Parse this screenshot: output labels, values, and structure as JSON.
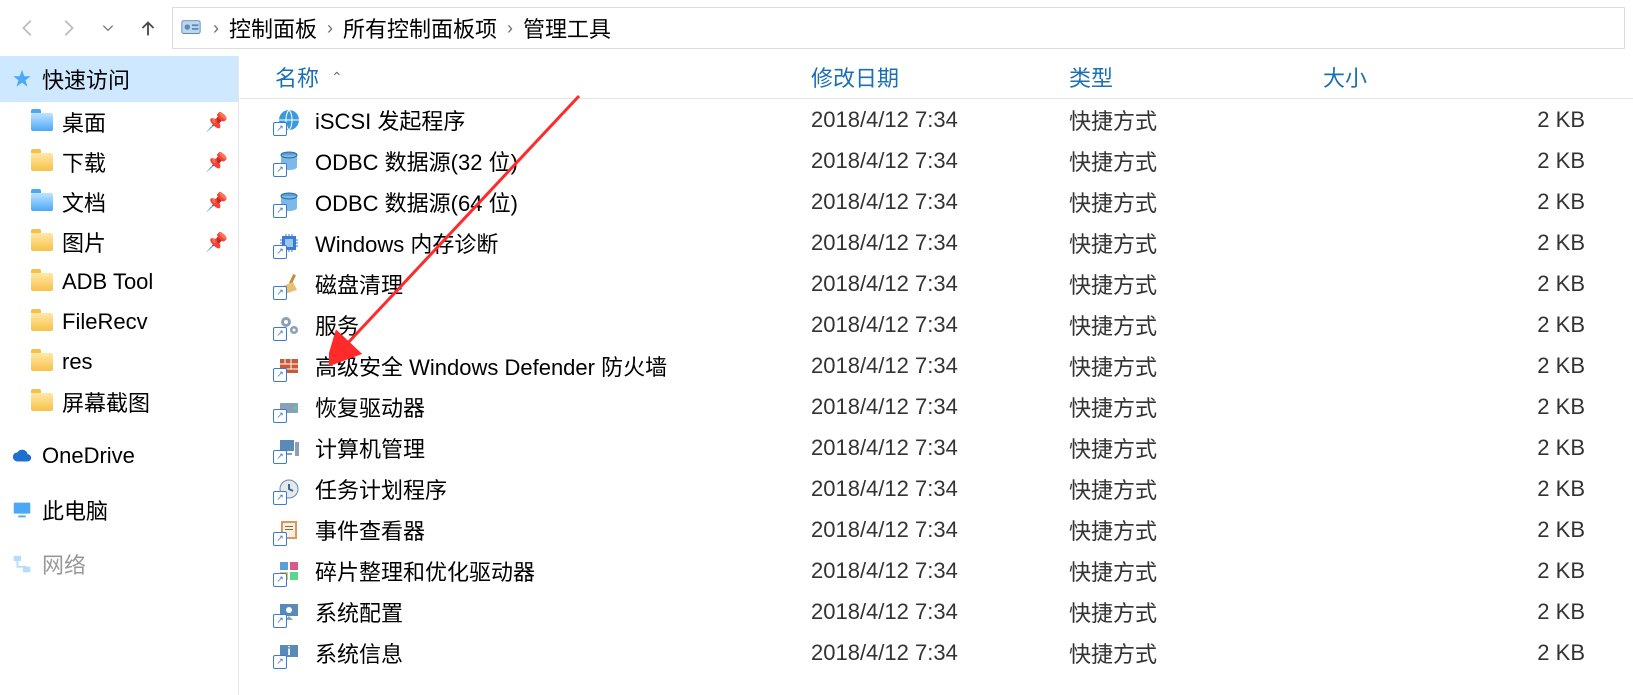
{
  "breadcrumbs": [
    "控制面板",
    "所有控制面板项",
    "管理工具"
  ],
  "nav": {
    "quick_access": "快速访问",
    "pinned": [
      {
        "label": "桌面",
        "color": "blue"
      },
      {
        "label": "下载",
        "color": "yellow"
      },
      {
        "label": "文档",
        "color": "blue"
      },
      {
        "label": "图片",
        "color": "yellow"
      }
    ],
    "recent": [
      {
        "label": "ADB Tool"
      },
      {
        "label": "FileRecv"
      },
      {
        "label": "res"
      },
      {
        "label": "屏幕截图"
      }
    ],
    "onedrive": "OneDrive",
    "this_pc": "此电脑",
    "network": "网络"
  },
  "columns": {
    "name": "名称",
    "date": "修改日期",
    "type": "类型",
    "size": "大小"
  },
  "rows": [
    {
      "name": "iSCSI 发起程序",
      "date": "2018/4/12 7:34",
      "type": "快捷方式",
      "size": "2 KB",
      "icon": "globe"
    },
    {
      "name": "ODBC 数据源(32 位)",
      "date": "2018/4/12 7:34",
      "type": "快捷方式",
      "size": "2 KB",
      "icon": "db"
    },
    {
      "name": "ODBC 数据源(64 位)",
      "date": "2018/4/12 7:34",
      "type": "快捷方式",
      "size": "2 KB",
      "icon": "db"
    },
    {
      "name": "Windows 内存诊断",
      "date": "2018/4/12 7:34",
      "type": "快捷方式",
      "size": "2 KB",
      "icon": "chip"
    },
    {
      "name": "磁盘清理",
      "date": "2018/4/12 7:34",
      "type": "快捷方式",
      "size": "2 KB",
      "icon": "broom"
    },
    {
      "name": "服务",
      "date": "2018/4/12 7:34",
      "type": "快捷方式",
      "size": "2 KB",
      "icon": "gears"
    },
    {
      "name": "高级安全 Windows Defender 防火墙",
      "date": "2018/4/12 7:34",
      "type": "快捷方式",
      "size": "2 KB",
      "icon": "wall"
    },
    {
      "name": "恢复驱动器",
      "date": "2018/4/12 7:34",
      "type": "快捷方式",
      "size": "2 KB",
      "icon": "disk"
    },
    {
      "name": "计算机管理",
      "date": "2018/4/12 7:34",
      "type": "快捷方式",
      "size": "2 KB",
      "icon": "pc"
    },
    {
      "name": "任务计划程序",
      "date": "2018/4/12 7:34",
      "type": "快捷方式",
      "size": "2 KB",
      "icon": "clock"
    },
    {
      "name": "事件查看器",
      "date": "2018/4/12 7:34",
      "type": "快捷方式",
      "size": "2 KB",
      "icon": "book"
    },
    {
      "name": "碎片整理和优化驱动器",
      "date": "2018/4/12 7:34",
      "type": "快捷方式",
      "size": "2 KB",
      "icon": "defrag"
    },
    {
      "name": "系统配置",
      "date": "2018/4/12 7:34",
      "type": "快捷方式",
      "size": "2 KB",
      "icon": "tool"
    },
    {
      "name": "系统信息",
      "date": "2018/4/12 7:34",
      "type": "快捷方式",
      "size": "2 KB",
      "icon": "info"
    }
  ]
}
